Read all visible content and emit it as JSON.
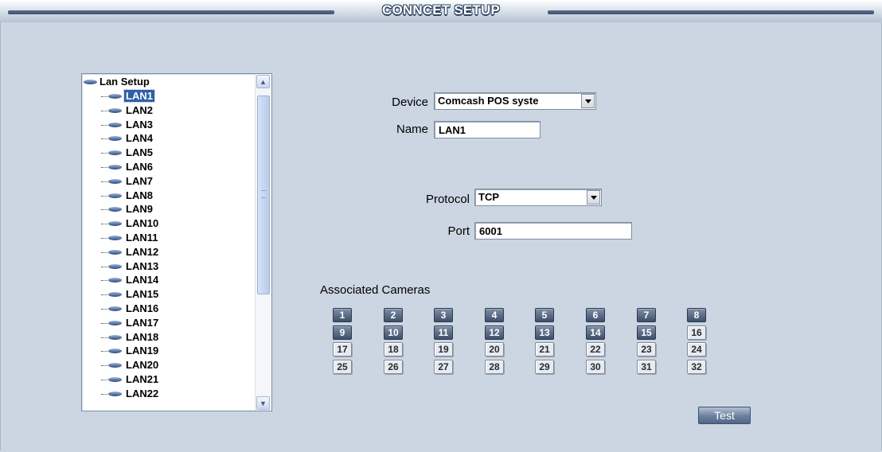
{
  "title": "CONNCET SETUP",
  "tree": {
    "root": "Lan Setup",
    "selected_index": 0,
    "items": [
      "LAN1",
      "LAN2",
      "LAN3",
      "LAN4",
      "LAN5",
      "LAN6",
      "LAN7",
      "LAN8",
      "LAN9",
      "LAN10",
      "LAN11",
      "LAN12",
      "LAN13",
      "LAN14",
      "LAN15",
      "LAN16",
      "LAN17",
      "LAN18",
      "LAN19",
      "LAN20",
      "LAN21",
      "LAN22"
    ]
  },
  "form": {
    "device_label": "Device",
    "device_value": "Comcash POS systе",
    "name_label": "Name",
    "name_value": "LAN1",
    "protocol_label": "Protocol",
    "protocol_value": "TCP",
    "port_label": "Port",
    "port_value": "6001"
  },
  "cameras": {
    "label": "Associated Cameras",
    "numbers": [
      1,
      2,
      3,
      4,
      5,
      6,
      7,
      8,
      9,
      10,
      11,
      12,
      13,
      14,
      15,
      16,
      17,
      18,
      19,
      20,
      21,
      22,
      23,
      24,
      25,
      26,
      27,
      28,
      29,
      30,
      31,
      32
    ],
    "selected": [
      1,
      2,
      3,
      4,
      5,
      6,
      7,
      8,
      9,
      10,
      11,
      12,
      13,
      14,
      15
    ]
  },
  "buttons": {
    "test_label": "Test"
  },
  "icons": {
    "tree_node": "lan-node-icon",
    "scroll_up": "scroll-up-arrow-icon",
    "scroll_down": "scroll-down-arrow-icon",
    "dropdown": "chevron-down-icon"
  }
}
